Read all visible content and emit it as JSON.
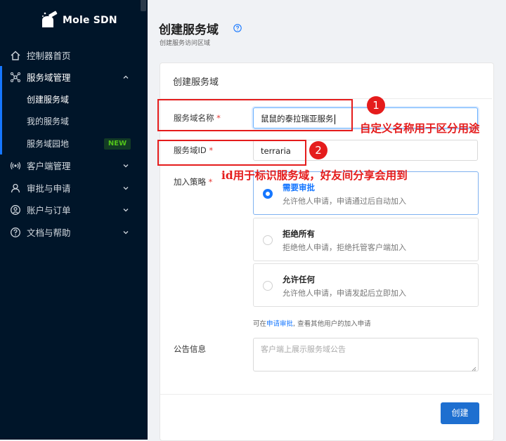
{
  "brand": {
    "name": "Mole SDN"
  },
  "sidebar": {
    "items": [
      {
        "label": "控制器首页",
        "icon": "home-icon"
      },
      {
        "label": "服务域管理",
        "icon": "network-icon"
      },
      {
        "label": "创建服务域",
        "icon": ""
      },
      {
        "label": "我的服务域",
        "icon": ""
      },
      {
        "label": "服务域园地",
        "icon": "",
        "badge": "NEW"
      },
      {
        "label": "客户端管理",
        "icon": "broadcast-icon"
      },
      {
        "label": "审批与申请",
        "icon": "user-group-icon"
      },
      {
        "label": "账户与订单",
        "icon": "user-circle-icon"
      },
      {
        "label": "文档与帮助",
        "icon": "question-icon"
      }
    ],
    "active_color": "#1677ff"
  },
  "page": {
    "title": "创建服务域",
    "subtitle": "创建服务访问区域"
  },
  "form": {
    "card_title": "创建服务域",
    "name": {
      "label": "服务域名称",
      "required": "*",
      "value": "鼠鼠的泰拉瑞亚服务"
    },
    "id": {
      "label": "服务域ID",
      "required": "*",
      "value": "terraria"
    },
    "policy": {
      "label": "加入策略",
      "required": "*",
      "options": [
        {
          "title": "需要审批",
          "desc": "允许他人申请，申请通过后自动加入",
          "selected": true
        },
        {
          "title": "拒绝所有",
          "desc": "拒绝他人申请，拒绝托管客户端加入",
          "selected": false
        },
        {
          "title": "允许任何",
          "desc": "允许他人申请，申请发起后立即加入",
          "selected": false
        }
      ],
      "hint_prefix": "可在",
      "hint_link": "申请审批",
      "hint_suffix": ", 查看其他用户的加入申请"
    },
    "notice": {
      "label": "公告信息",
      "placeholder": "客户端上展示服务域公告"
    },
    "submit_label": "创建"
  },
  "annotations": {
    "circle1": "1",
    "circle2": "2",
    "note1": "自定义名称用于区分用途",
    "note2": "id用于标识服务域，好友间分享会用到",
    "color": "#e51c1c"
  }
}
